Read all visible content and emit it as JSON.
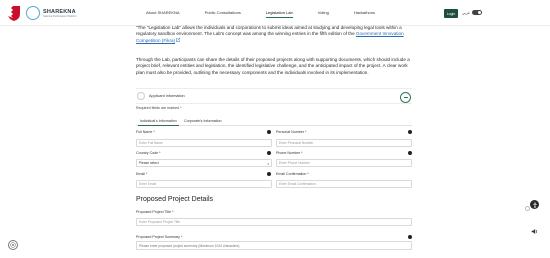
{
  "header": {
    "logo_name": "SHAREKNA",
    "logo_subtitle": "National Participation Platform",
    "nav": [
      {
        "label": "About SHAREKNA"
      },
      {
        "label": "Public Consultations"
      },
      {
        "label": "Legislation Lab",
        "active": true
      },
      {
        "label": "Voting"
      },
      {
        "label": "Hackathons"
      }
    ],
    "login_label": "Login",
    "language_label": "عربي"
  },
  "intro": {
    "para1_text": "\"The \"Legislation Lab\" allows the individuals and corporations to submit ideas aimed at studying and developing legal tools within a regulatory sandbox environment. The Lab's concept was among the winning entries in the fifth edition of the ",
    "para1_link": "Government Innovation Competition (Fikra)",
    "para1_link_icon": "external-link-icon",
    "para2_text": "Through the Lab, participants can share the details of their proposed projects along with supporting documents, which should include a project brief, relevant entities and legislation, the identified legislative challenge, and the anticipated impact of the project. A clear work plan must also be provided, outlining the necessary components and the individuals involved in its implementation."
  },
  "applicant": {
    "title": "Applicant Information",
    "required_note": "Required fields are marked *",
    "tabs": [
      {
        "label": "Individual's Information",
        "active": true
      },
      {
        "label": "Corporate's Information",
        "active": false
      }
    ]
  },
  "form": {
    "full_name": {
      "label": "Full Name *",
      "placeholder": "Enter Full Name"
    },
    "personal_number": {
      "label": "Personal Number *",
      "placeholder": "Enter Personal Number"
    },
    "country_code": {
      "label": "Country Code *",
      "value": "Please select"
    },
    "phone_number": {
      "label": "Phone Number *",
      "placeholder": "Enter Phone Number"
    },
    "email": {
      "label": "Email *",
      "placeholder": "Enter Email"
    },
    "email_confirmation": {
      "label": "Email Confirmation *",
      "placeholder": "Enter Email Confirmation"
    }
  },
  "project": {
    "section_title": "Proposed Project Details",
    "title_field": {
      "label": "Proposed Project Title *",
      "placeholder": "Enter Proposed Project Title"
    },
    "summary_field": {
      "label": "Proposed Project Summary *",
      "placeholder": "Please enter proposed project summary (Maximum 1024 characters)"
    }
  },
  "colors": {
    "accent_green": "#1d4f3a",
    "link_blue": "#2a6cb3",
    "logo_teal": "#5aa9c7"
  }
}
